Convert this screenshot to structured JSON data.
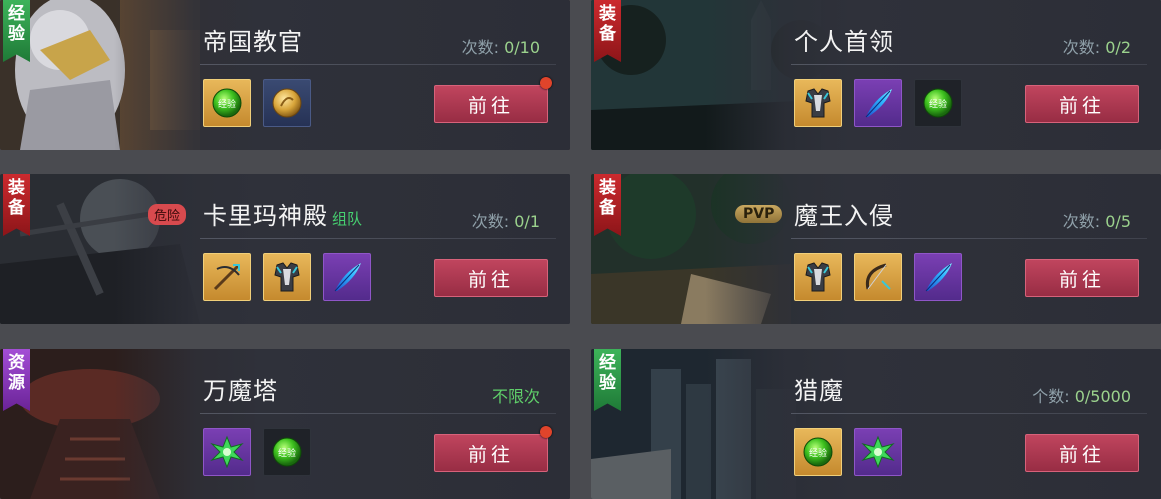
{
  "go_label": "前往",
  "cards": [
    {
      "tag": "经验",
      "tag_color": "green",
      "title": "帝国教官",
      "count_label": "次数:",
      "count_value": "0/10",
      "items": [
        "exp-orb-icon",
        "gold-coin-icon"
      ],
      "red_dot": true
    },
    {
      "tag": "装备",
      "tag_color": "red",
      "title": "个人首领",
      "count_label": "次数:",
      "count_value": "0/2",
      "items": [
        "chest-armor-icon",
        "blue-feather-icon",
        "exp-orb-icon"
      ],
      "red_dot": false
    },
    {
      "tag": "装备",
      "tag_color": "red",
      "prefix": "危险",
      "title": "卡里玛神殿",
      "subtitle": "组队",
      "count_label": "次数:",
      "count_value": "0/1",
      "items": [
        "crossbow-icon",
        "chest-armor-icon",
        "blue-feather-icon"
      ],
      "red_dot": false
    },
    {
      "tag": "装备",
      "tag_color": "red",
      "prefix": "PVP",
      "title": "魔王入侵",
      "count_label": "次数:",
      "count_value": "0/5",
      "items": [
        "chest-armor-icon",
        "bow-icon",
        "blue-feather-icon"
      ],
      "red_dot": false
    },
    {
      "tag": "资源",
      "tag_color": "purple",
      "title": "万魔塔",
      "count_text": "不限次",
      "items": [
        "green-crystal-icon",
        "exp-orb-icon"
      ],
      "red_dot": true
    },
    {
      "tag": "经验",
      "tag_color": "green",
      "title": "猎魔",
      "count_label": "个数:",
      "count_value": "0/5000",
      "items": [
        "exp-orb-icon",
        "green-crystal-icon"
      ],
      "red_dot": false
    }
  ],
  "icon_labels": {
    "exp": "经验"
  }
}
